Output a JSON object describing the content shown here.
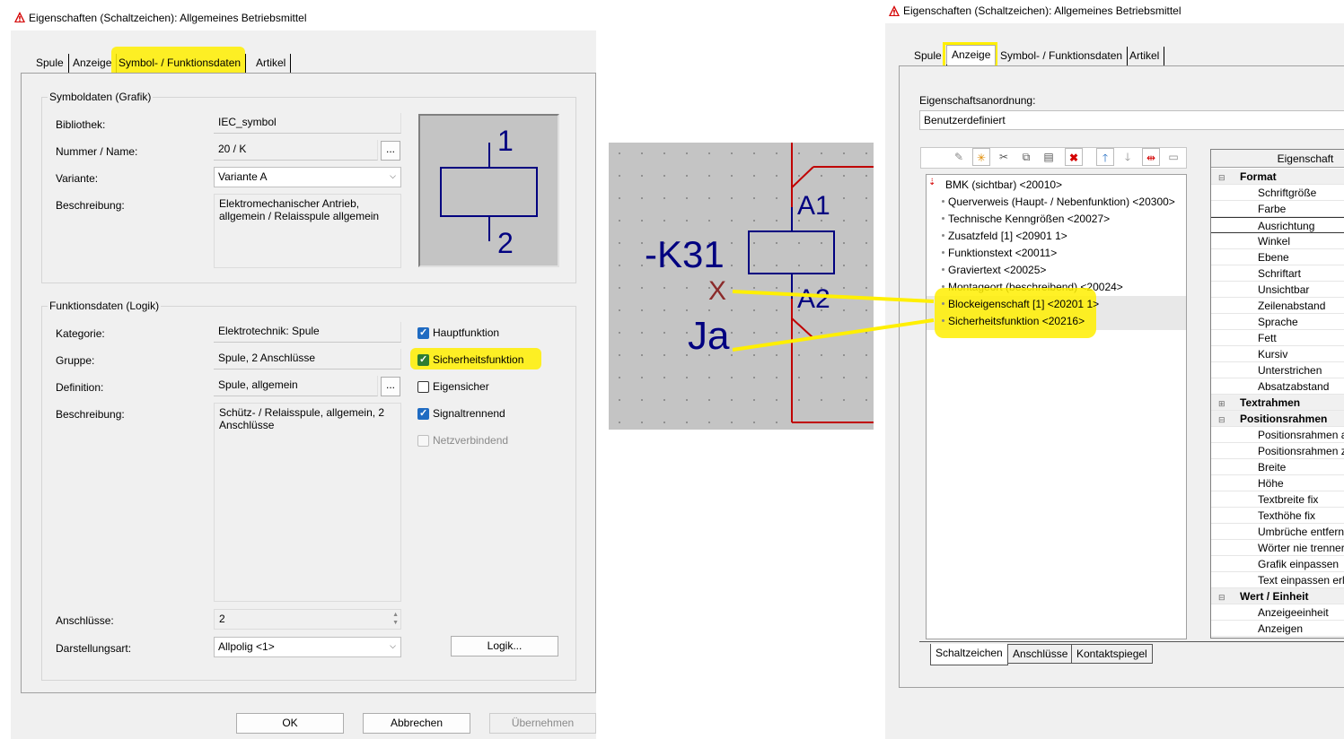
{
  "left_dialog": {
    "title": "Eigenschaften (Schaltzeichen): Allgemeines Betriebsmittel",
    "tabs": [
      "Spule",
      "Anzeige",
      "Symbol- / Funktionsdaten",
      "Artikel"
    ],
    "symbol_group": {
      "title": "Symboldaten (Grafik)",
      "bibliothek_label": "Bibliothek:",
      "bibliothek_value": "IEC_symbol",
      "nummer_label": "Nummer / Name:",
      "nummer_value": "20 / K",
      "variante_label": "Variante:",
      "variante_value": "Variante A",
      "beschreibung_label": "Beschreibung:",
      "beschreibung_value": "Elektromechanischer Antrieb, allgemein / Relaisspule allgemein",
      "preview_top": "1",
      "preview_bottom": "2"
    },
    "function_group": {
      "title": "Funktionsdaten (Logik)",
      "kategorie_label": "Kategorie:",
      "kategorie_value": "Elektrotechnik: Spule",
      "gruppe_label": "Gruppe:",
      "gruppe_value": "Spule, 2 Anschlüsse",
      "definition_label": "Definition:",
      "definition_value": "Spule, allgemein",
      "beschreibung_label": "Beschreibung:",
      "beschreibung_value": "Schütz- / Relaisspule, allgemein, 2 Anschlüsse",
      "anschluesse_label": "Anschlüsse:",
      "anschluesse_value": "2",
      "darstellung_label": "Darstellungsart:",
      "darstellung_value": "Allpolig <1>",
      "checkboxes": [
        {
          "label": "Hauptfunktion",
          "checked": true
        },
        {
          "label": "Sicherheitsfunktion",
          "checked": true
        },
        {
          "label": "Eigensicher",
          "checked": false
        },
        {
          "label": "Signaltrennend",
          "checked": true
        },
        {
          "label": "Netzverbindend",
          "checked": false
        }
      ],
      "logik_button": "Logik..."
    },
    "buttons": {
      "ok": "OK",
      "cancel": "Abbrechen",
      "apply": "Übernehmen"
    }
  },
  "schematic": {
    "bmk": "-K31",
    "label_a1": "A1",
    "label_a2": "A2",
    "block_mark": "X",
    "safety_value": "Ja"
  },
  "right_dialog": {
    "title": "Eigenschaften (Schaltzeichen): Allgemeines Betriebsmittel",
    "tabs": [
      "Spule",
      "Anzeige",
      "Symbol- / Funktionsdaten",
      "Artikel"
    ],
    "anordnung_label": "Eigenschaftsanordnung:",
    "anordnung_value": "Benutzerdefiniert",
    "tree_items": [
      "BMK (sichtbar) <20010>",
      "Querverweis (Haupt- / Nebenfunktion) <20300>",
      "Technische Kenngrößen <20027>",
      "Zusatzfeld [1] <20901 1>",
      "Funktionstext <20011>",
      "Graviertext <20025>",
      "Montageort (beschreibend) <20024>",
      "Blockeigenschaft [1] <20201 1>",
      "Sicherheitsfunktion <20216>"
    ],
    "prop_header": "Eigenschaft",
    "props": [
      {
        "text": "Format",
        "header": true
      },
      {
        "text": "Schriftgröße",
        "header": false
      },
      {
        "text": "Farbe",
        "header": false
      },
      {
        "text": "Ausrichtung",
        "header": false
      },
      {
        "text": "Winkel",
        "header": false
      },
      {
        "text": "Ebene",
        "header": false
      },
      {
        "text": "Schriftart",
        "header": false
      },
      {
        "text": "Unsichtbar",
        "header": false
      },
      {
        "text": "Zeilenabstand",
        "header": false
      },
      {
        "text": "Sprache",
        "header": false
      },
      {
        "text": "Fett",
        "header": false
      },
      {
        "text": "Kursiv",
        "header": false
      },
      {
        "text": "Unterstrichen",
        "header": false
      },
      {
        "text": "Absatzabstand",
        "header": false
      },
      {
        "text": "Textrahmen",
        "header": true
      },
      {
        "text": "Positionsrahmen",
        "header": true
      },
      {
        "text": "Positionsrahmen a",
        "header": false
      },
      {
        "text": "Positionsrahmen z",
        "header": false
      },
      {
        "text": "Breite",
        "header": false
      },
      {
        "text": "Höhe",
        "header": false
      },
      {
        "text": "Textbreite fix",
        "header": false
      },
      {
        "text": "Texthöhe fix",
        "header": false
      },
      {
        "text": "Umbrüche entfern",
        "header": false
      },
      {
        "text": "Wörter nie trenner",
        "header": false
      },
      {
        "text": "Grafik einpassen",
        "header": false
      },
      {
        "text": "Text einpassen erla",
        "header": false
      },
      {
        "text": "Wert / Einheit",
        "header": true
      },
      {
        "text": "Anzeigeeinheit",
        "header": false
      },
      {
        "text": "Anzeigen",
        "header": false
      }
    ],
    "bottom_tabs": [
      "Schaltzeichen",
      "Anschlüsse",
      "Kontaktspiegel"
    ]
  },
  "colors": {
    "highlight": "#ffef00",
    "wire": "#c00000",
    "symbol": "#000080",
    "check": "#1f6bc2"
  }
}
